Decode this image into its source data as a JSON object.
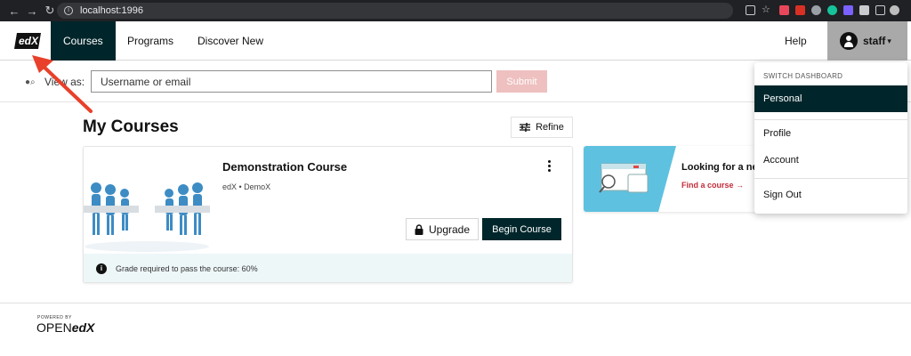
{
  "browser": {
    "url": "localhost:1996"
  },
  "header": {
    "logo_alt": "edX",
    "nav": [
      {
        "label": "Courses"
      },
      {
        "label": "Programs"
      },
      {
        "label": "Discover New"
      }
    ],
    "help_label": "Help",
    "user_label": "staff"
  },
  "view_as": {
    "label": "View as:",
    "placeholder": "Username or email",
    "submit_label": "Submit"
  },
  "main": {
    "title": "My Courses",
    "refine_label": "Refine"
  },
  "course_card": {
    "title": "Demonstration Course",
    "meta": "edX • DemoX",
    "upgrade_label": "Upgrade",
    "begin_label": "Begin Course",
    "grade_note": "Grade required to pass the course: 60%"
  },
  "promo": {
    "title": "Looking for a ne",
    "link_label": "Find a course →"
  },
  "dropdown": {
    "header": "SWITCH DASHBOARD",
    "items": [
      {
        "label": "Personal"
      },
      {
        "label": "Profile"
      },
      {
        "label": "Account"
      },
      {
        "label": "Sign Out"
      }
    ]
  },
  "footer": {
    "powered_by": "POWERED BY",
    "open_text": "OPEN",
    "edx_text": "edX"
  },
  "colors": {
    "brand_dark": "#00262b",
    "accent_red": "#c32d3a",
    "annotation_arrow": "#e8402a"
  }
}
